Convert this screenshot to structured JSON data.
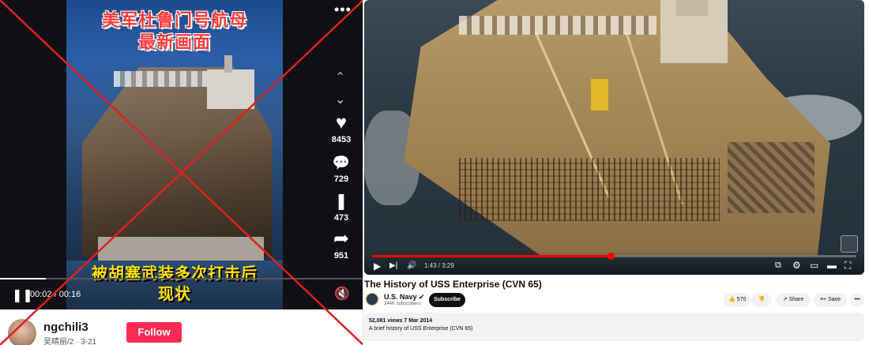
{
  "tiktok": {
    "caption_top_line1": "美军杜鲁门号航母",
    "caption_top_line2": "最新画面",
    "caption_bottom_line1": "被胡塞武装多次打击后",
    "caption_bottom_line2": "现状",
    "more_glyph": "•••",
    "likes": "8453",
    "comments": "729",
    "saves": "473",
    "shares": "951",
    "time": "00:02 / 00:16",
    "username": "ngchili3",
    "subline": "吴晴丽/2 · 3-21",
    "follow_label": "Follow",
    "up_glyph": "⌃",
    "down_glyph": "⌄",
    "like_glyph": "♥",
    "comment_glyph": "💬",
    "save_glyph": "❚",
    "share_glyph": "➦",
    "pause_glyph": "❚❚",
    "mute_glyph": "🔇",
    "progress": 0.125
  },
  "youtube": {
    "title": "The History of USS Enterprise (CVN 65)",
    "channel": "U.S. Navy ✔",
    "subscribers": "344K subscribers",
    "subscribe_label": "Subscribe",
    "likes": "570",
    "share_label": "Share",
    "save_label": "Save",
    "more_glyph": "•••",
    "stats": "52,081 views  7 Mar 2014",
    "description": "A brief history of USS Enterprise (CVN 65)",
    "time": "1:43 / 3:29",
    "progress": 0.493,
    "play_glyph": "▶",
    "next_glyph": "▶|",
    "volume_glyph": "🔊",
    "cc_glyph": "⧉",
    "gear_glyph": "⚙",
    "miniplayer_glyph": "▭",
    "theater_glyph": "▬",
    "fullscreen_glyph": "⛶",
    "like_glyph": "👍",
    "dislike_glyph": "👎",
    "share_glyph": "↗",
    "save_glyph": "≡+"
  },
  "colors": {
    "cross": "#e02020",
    "tiktok_follow": "#fe2c55",
    "yt_progress": "#ff0000"
  }
}
